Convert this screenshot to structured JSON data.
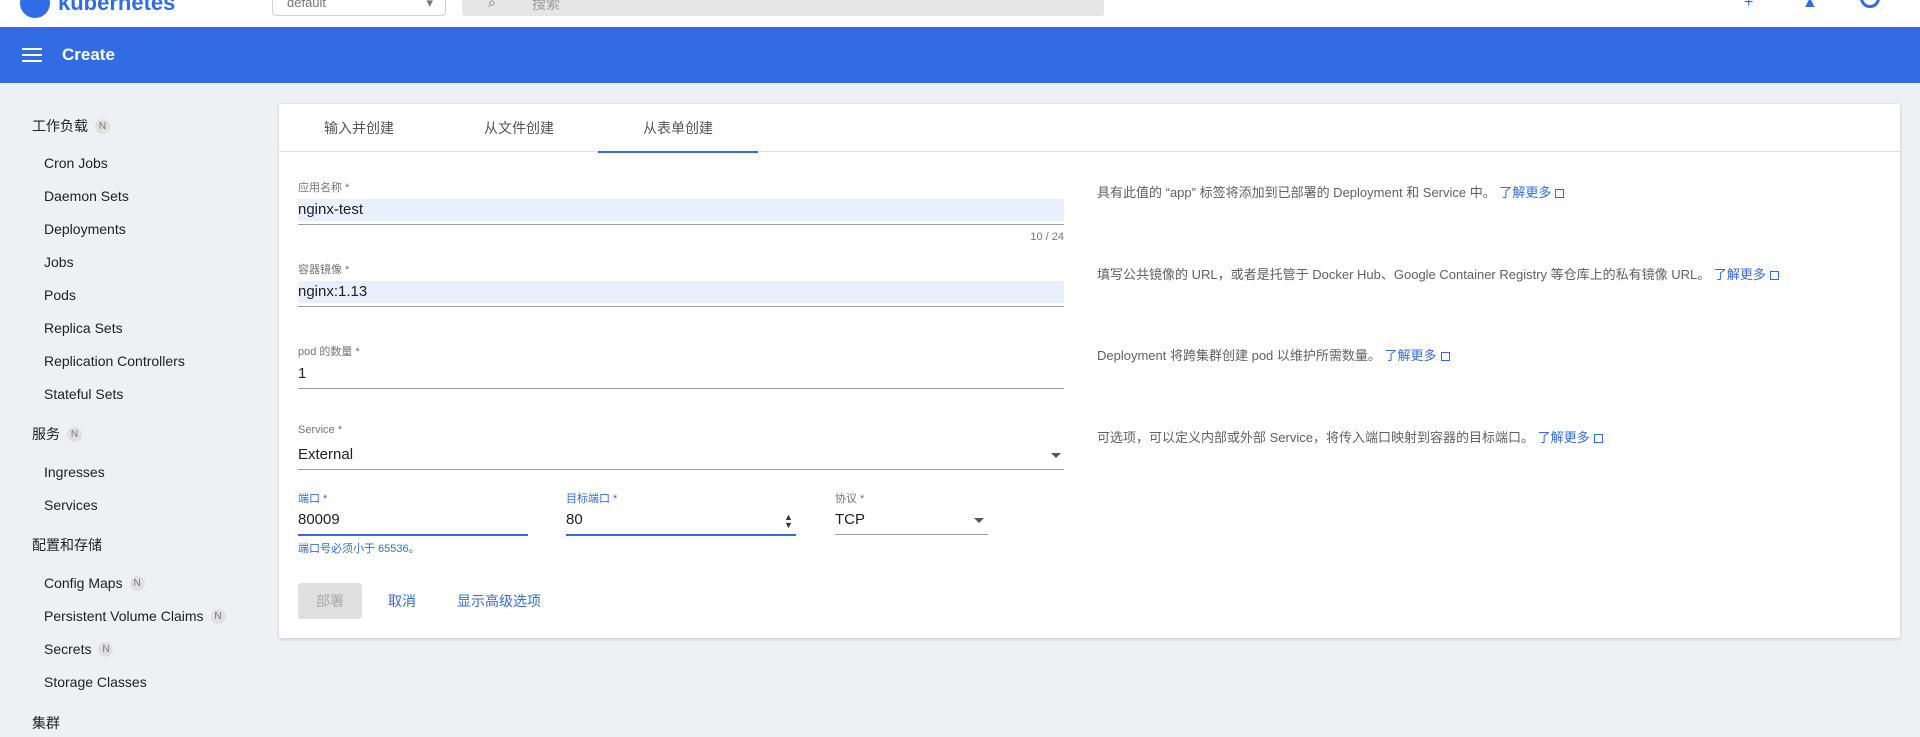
{
  "topbar": {
    "brand": "kubernetes",
    "namespace": "default",
    "search_placeholder": "搜索"
  },
  "appbar": {
    "title": "Create"
  },
  "sidebar": {
    "groups": [
      {
        "label": "工作负载",
        "badge": "N",
        "items": [
          {
            "label": "Cron Jobs"
          },
          {
            "label": "Daemon Sets"
          },
          {
            "label": "Deployments"
          },
          {
            "label": "Jobs"
          },
          {
            "label": "Pods"
          },
          {
            "label": "Replica Sets"
          },
          {
            "label": "Replication Controllers"
          },
          {
            "label": "Stateful Sets"
          }
        ]
      },
      {
        "label": "服务",
        "badge": "N",
        "items": [
          {
            "label": "Ingresses"
          },
          {
            "label": "Services"
          }
        ]
      },
      {
        "label": "配置和存储",
        "items": [
          {
            "label": "Config Maps",
            "badge": "N"
          },
          {
            "label": "Persistent Volume Claims",
            "badge": "N"
          },
          {
            "label": "Secrets",
            "badge": "N"
          },
          {
            "label": "Storage Classes"
          }
        ]
      },
      {
        "label": "集群"
      }
    ]
  },
  "tabs": [
    {
      "label": "输入并创建"
    },
    {
      "label": "从文件创建"
    },
    {
      "label": "从表单创建",
      "active": true
    }
  ],
  "form": {
    "app_name": {
      "label": "应用名称 *",
      "value": "nginx-test",
      "counter": "10 / 24",
      "hint": "具有此值的 “app” 标签将添加到已部署的 Deployment 和 Service 中。",
      "link": "了解更多"
    },
    "image": {
      "label": "容器镜像 *",
      "value": "nginx:1.13",
      "hint": "填写公共镜像的 URL，或者是托管于 Docker Hub、Google Container Registry 等仓库上的私有镜像 URL。",
      "link": "了解更多"
    },
    "pods": {
      "label": "pod 的数量 *",
      "value": "1",
      "hint": "Deployment 将跨集群创建 pod 以维护所需数量。",
      "link": "了解更多"
    },
    "service": {
      "label": "Service *",
      "value": "External",
      "hint": "可选项，可以定义内部或外部 Service，将传入端口映射到容器的目标端口。",
      "link": "了解更多"
    },
    "port": {
      "label": "端口 *",
      "value": "80009",
      "error": "端口号必须小于 65536。"
    },
    "target_port": {
      "label": "目标端口 *",
      "value": "80"
    },
    "protocol": {
      "label": "协议 *",
      "value": "TCP"
    }
  },
  "actions": {
    "deploy": "部署",
    "cancel": "取消",
    "advanced": "显示高级选项"
  },
  "colors": {
    "primary": "#326ce5",
    "background": "#eef0f3"
  }
}
